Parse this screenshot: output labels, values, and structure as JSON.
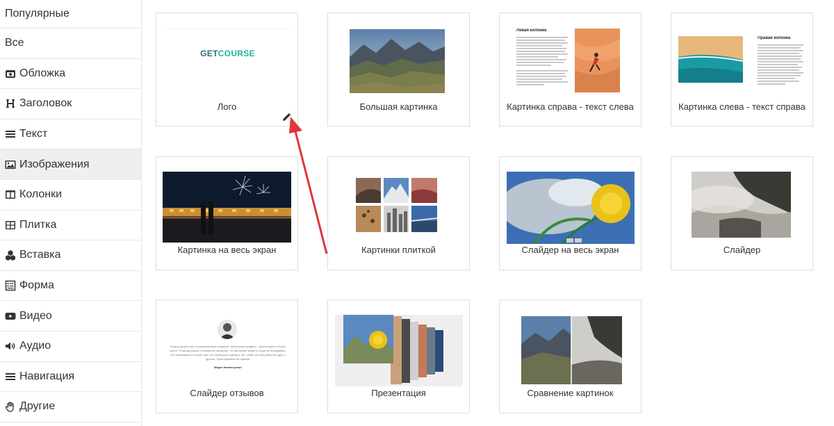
{
  "sidebar": {
    "items": [
      {
        "label": "Популярные",
        "icon": "none"
      },
      {
        "label": "Все",
        "icon": "none"
      },
      {
        "label": "Обложка",
        "icon": "cover-icon"
      },
      {
        "label": "Заголовок",
        "icon": "heading-icon"
      },
      {
        "label": "Текст",
        "icon": "text-lines-icon"
      },
      {
        "label": "Изображения",
        "icon": "image-icon"
      },
      {
        "label": "Колонки",
        "icon": "columns-icon"
      },
      {
        "label": "Плитка",
        "icon": "tile-icon"
      },
      {
        "label": "Вставка",
        "icon": "cubes-icon"
      },
      {
        "label": "Форма",
        "icon": "form-icon"
      },
      {
        "label": "Видео",
        "icon": "video-icon"
      },
      {
        "label": "Аудио",
        "icon": "audio-icon"
      },
      {
        "label": "Навигация",
        "icon": "navigation-icon"
      },
      {
        "label": "Другие",
        "icon": "hand-icon"
      }
    ],
    "active_index": 5
  },
  "blocks": [
    {
      "label": "Лого",
      "logo_text_1": "GET",
      "logo_text_2": "COURSE"
    },
    {
      "label": "Большая картинка"
    },
    {
      "label": "Картинка справа - текст слева",
      "preview_heading": "Левая колонка"
    },
    {
      "label": "Картинка слева - текст справа",
      "preview_heading": "Правая колонка"
    },
    {
      "label": "Картинка на весь экран"
    },
    {
      "label": "Картинки плиткой"
    },
    {
      "label": "Слайдер на весь экран"
    },
    {
      "label": "Слайдер"
    },
    {
      "label": "Слайдер отзывов",
      "preview_quote": "Можно делать все на разрешенных сервисах. Мейтченко воедино... бухгалтерию в Excel вести. Я сам до какого-то момента так делал. Но наступает момент, когда ты понимаешь, что занимаешься только тем, что пытаешься сделать так, чтобы это все работало друг с другом. Трата времени не нужная.",
      "preview_author": "Марат Нигматуллин"
    },
    {
      "label": "Презентация"
    },
    {
      "label": "Сравнение картинок"
    }
  ],
  "colors": {
    "logo_dark": "#2b6a7a",
    "logo_accent": "#19b5a5",
    "arrow": "#e0353b",
    "active_item_bg": "#efefef"
  }
}
